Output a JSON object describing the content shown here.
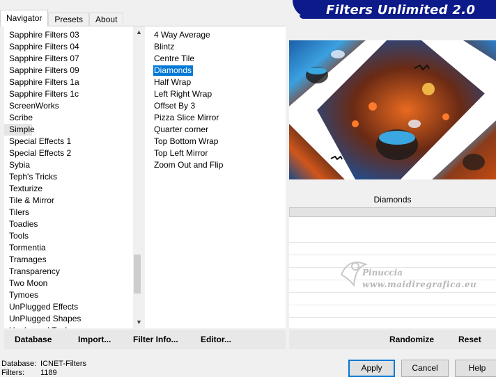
{
  "tabs": [
    {
      "label": "Navigator",
      "active": true
    },
    {
      "label": "Presets",
      "active": false
    },
    {
      "label": "About",
      "active": false
    }
  ],
  "banner": {
    "title": "Filters Unlimited 2.0"
  },
  "categories": {
    "items": [
      "Sapphire Filters 03",
      "Sapphire Filters 04",
      "Sapphire Filters 07",
      "Sapphire Filters 09",
      "Sapphire Filters 1a",
      "Sapphire Filters 1c",
      "ScreenWorks",
      "Scribe",
      "Simple",
      "Special Effects 1",
      "Special Effects 2",
      "Sybia",
      "Teph's Tricks",
      "Texturize",
      "Tile & Mirror",
      "Tilers",
      "Toadies",
      "Tools",
      "Tormentia",
      "Tramages",
      "Transparency",
      "Two Moon",
      "Tymoes",
      "UnPlugged Effects",
      "UnPlugged Shapes",
      "Unplugged Tools"
    ],
    "selected": "Simple"
  },
  "filters": {
    "items": [
      "4 Way Average",
      "Blintz",
      "Centre Tile",
      "Diamonds",
      "Half Wrap",
      "Left Right Wrap",
      "Offset By 3",
      "Pizza Slice Mirror",
      "Quarter corner",
      "Top Bottom Wrap",
      "Top Left Mirror",
      "Zoom Out and Flip"
    ],
    "selected": "Diamonds"
  },
  "preview": {
    "filter_name": "Diamonds"
  },
  "watermark": {
    "name": "Pinuccia",
    "site": "www.maidiregrafica.eu"
  },
  "toolbar": {
    "database": "Database",
    "import": "Import...",
    "filter_info": "Filter Info...",
    "editor": "Editor...",
    "randomize": "Randomize",
    "reset": "Reset"
  },
  "status": {
    "database_label": "Database:",
    "database_value": "ICNET-Filters",
    "filters_label": "Filters:",
    "filters_value": "1189"
  },
  "buttons": {
    "apply": "Apply",
    "cancel": "Cancel",
    "help": "Help"
  },
  "colors": {
    "banner": "#0c1a8a",
    "selection": "#0078d7"
  }
}
